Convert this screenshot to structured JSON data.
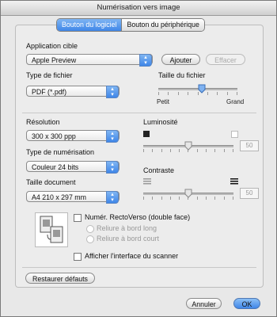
{
  "window": {
    "title": "Numérisation vers image"
  },
  "tabs": [
    {
      "label": "Bouton du logiciel"
    },
    {
      "label": "Bouton du périphérique"
    }
  ],
  "app_target": {
    "label": "Application cible",
    "selected": "Apple Preview",
    "add_label": "Ajouter",
    "remove_label": "Effacer"
  },
  "file_type": {
    "label": "Type de fichier",
    "selected": "PDF (*.pdf)"
  },
  "file_size": {
    "label": "Taille du fichier",
    "min_label": "Petit",
    "max_label": "Grand",
    "level": 0.55
  },
  "resolution": {
    "label": "Résolution",
    "selected": "300 x 300 ppp"
  },
  "scan_type": {
    "label": "Type de numérisation",
    "selected": "Couleur 24 bits"
  },
  "doc_size": {
    "label": "Taille document",
    "selected": "A4  210 x 297 mm"
  },
  "brightness": {
    "label": "Luminosité",
    "value": "50",
    "level": 0.5
  },
  "contrast": {
    "label": "Contraste",
    "value": "50",
    "level": 0.5
  },
  "duplex": {
    "checkbox_label": "Numér. RectoVerso (double face)",
    "long_edge_label": "Reliure à bord long",
    "short_edge_label": "Reliure à bord court"
  },
  "show_scanner_ui": {
    "label": "Afficher l'interface du scanner"
  },
  "footer": {
    "restore_label": "Restaurer défauts",
    "cancel_label": "Annuler",
    "ok_label": "OK"
  }
}
